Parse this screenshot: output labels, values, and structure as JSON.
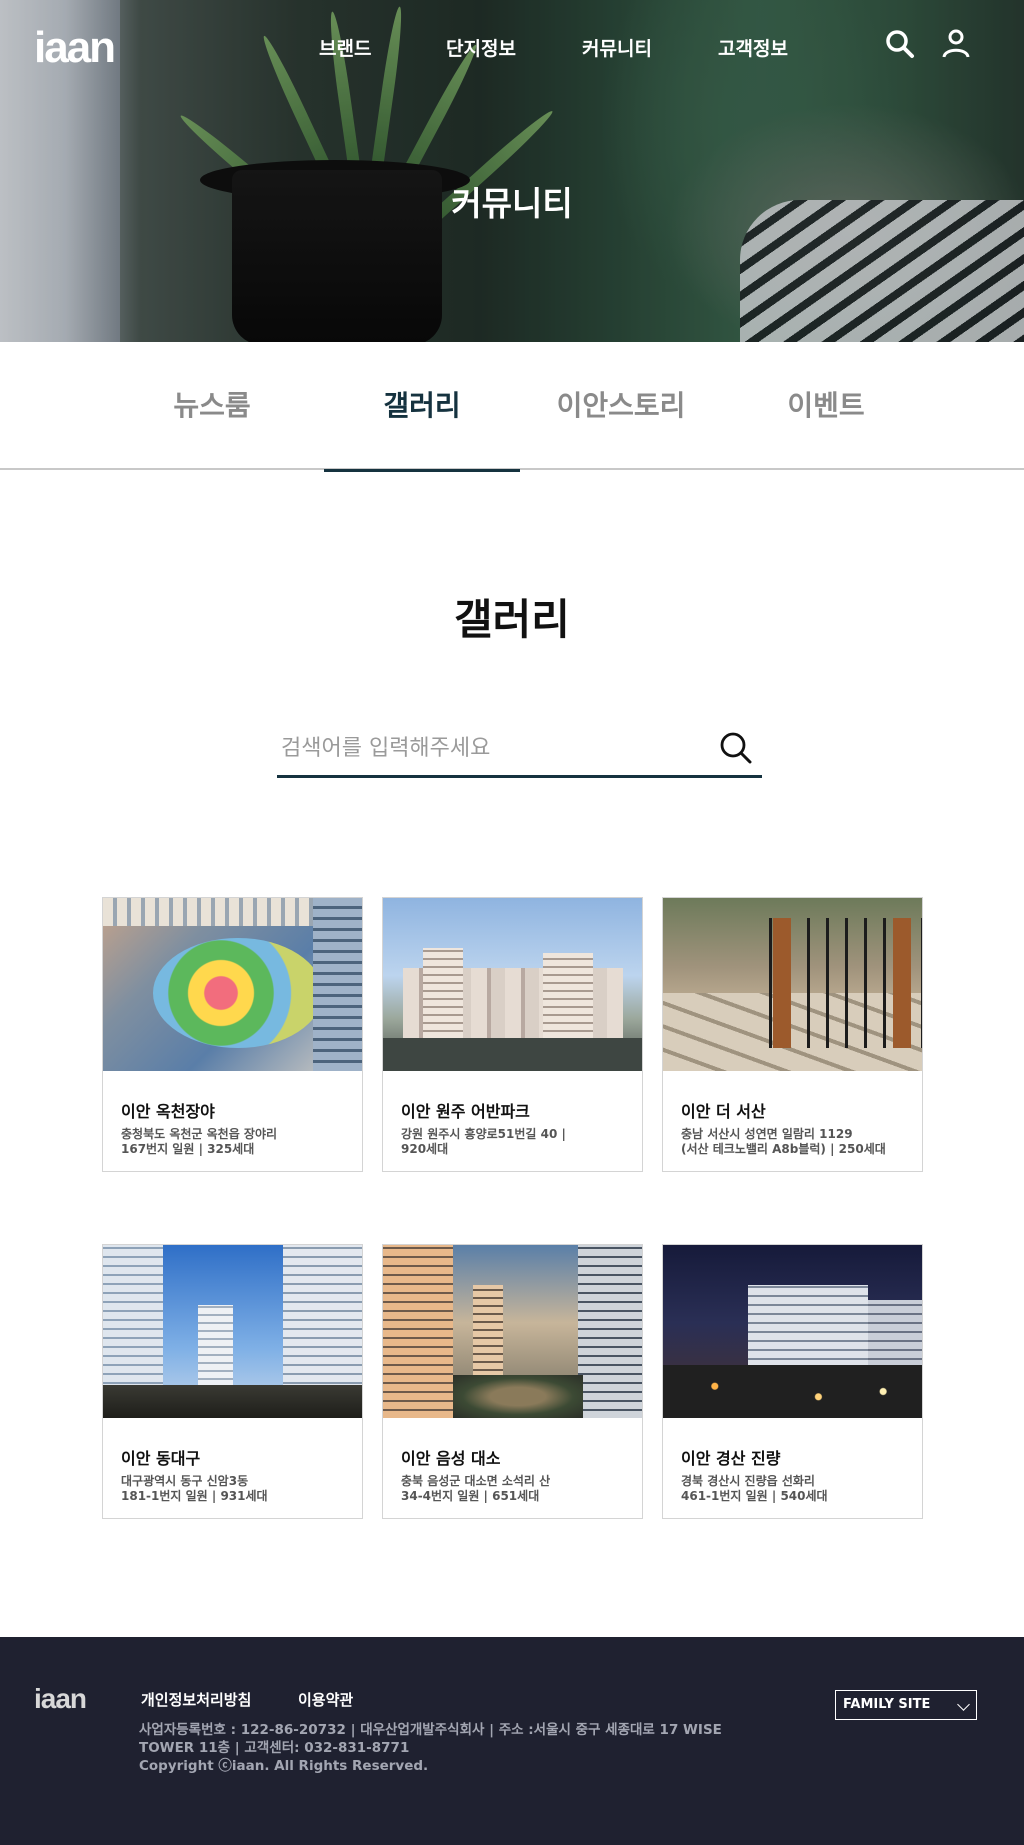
{
  "header": {
    "logo": "iaan",
    "nav": [
      "브랜드",
      "단지정보",
      "커뮤니티",
      "고객정보"
    ],
    "hero_title": "커뮤니티",
    "icons": [
      "search-icon",
      "user-icon"
    ]
  },
  "tabs": [
    {
      "label": "뉴스룸",
      "active": false
    },
    {
      "label": "갤러리",
      "active": true
    },
    {
      "label": "이안스토리",
      "active": false
    },
    {
      "label": "이벤트",
      "active": false
    }
  ],
  "section_title": "갤러리",
  "search": {
    "placeholder": "검색어를 입력해주세요",
    "value": ""
  },
  "gallery": [
    {
      "name": "이안 옥천장야",
      "addr1": "충청북도 옥천군 옥천읍 장야리",
      "addr2": "167번지 일원 | 325세대"
    },
    {
      "name": "이안 원주 어반파크",
      "addr1": "강원 원주시 흥양로51번길 40 |",
      "addr2": "920세대"
    },
    {
      "name": "이안 더 서산",
      "addr1": "충남 서산시 성연면 일람리 1129",
      "addr2": "(서산 테크노밸리 A8b블럭) | 250세대"
    },
    {
      "name": "이안 동대구",
      "addr1": "대구광역시 동구 신암3동",
      "addr2": "181-1번지 일원 | 931세대"
    },
    {
      "name": "이안 음성 대소",
      "addr1": "충북 음성군 대소면 소석리 산",
      "addr2": "34-4번지 일원 | 651세대"
    },
    {
      "name": "이안  경산 진량",
      "addr1": "경북 경산시 진량읍 선화리",
      "addr2": "461-1번지 일원 | 540세대"
    }
  ],
  "footer": {
    "logo": "iaan",
    "links": [
      "개인정보처리방침",
      "이용약관"
    ],
    "info_line1": "사업자등록번호 : 122-86-20732   |   대우산업개발주식회사   |   주소 :서울시 중구 세종대로 17 WISE",
    "info_line2": "TOWER 11층   |   고객센터: 032-831-8771",
    "copyright": "Copyright ⓒiaan. All Rights Reserved.",
    "family_site": "FAMILY SITE"
  },
  "colors": {
    "accent": "#15323f",
    "footer_bg": "#1f2130",
    "tab_inactive": "#8a8a8a"
  }
}
